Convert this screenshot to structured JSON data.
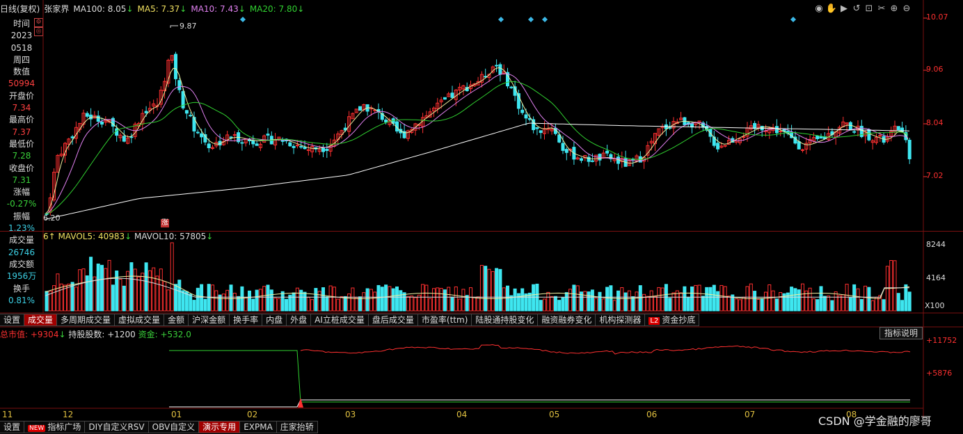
{
  "header": {
    "period": "日线(复权)",
    "stock": "张家界",
    "ma100": "MA100: 8.05",
    "ma5": "MA5: 7.37",
    "ma10": "MA10: 7.43",
    "ma20": "MA20: 7.80",
    "arrow": "↓"
  },
  "info": [
    {
      "label": "时间",
      "value": "2023",
      "cls": "vw"
    },
    {
      "label": "",
      "value": "0518",
      "cls": "vw"
    },
    {
      "label": "",
      "value": "周四",
      "cls": "vw"
    },
    {
      "label": "数值",
      "value": "50994",
      "cls": "vr"
    },
    {
      "label": "开盘价",
      "value": "7.34",
      "cls": "vr"
    },
    {
      "label": "最高价",
      "value": "7.37",
      "cls": "vr"
    },
    {
      "label": "最低价",
      "value": "7.28",
      "cls": "vg"
    },
    {
      "label": "收盘价",
      "value": "7.31",
      "cls": "vg"
    },
    {
      "label": "涨幅",
      "value": "-0.27%",
      "cls": "vg"
    },
    {
      "label": "振幅",
      "value": "1.23%",
      "cls": "vc"
    },
    {
      "label": "成交量",
      "value": "26746",
      "cls": "vc"
    },
    {
      "label": "成交额",
      "value": "1956万",
      "cls": "vc"
    },
    {
      "label": "换手",
      "value": "0.81%",
      "cls": "vc"
    }
  ],
  "price_axis": [
    "10.07",
    "9.06",
    "8.04",
    "7.02"
  ],
  "high_label": "9.87",
  "low_label": "6.20",
  "stop_mark": "涨",
  "volume": {
    "header_prefix": "6↑",
    "mavol5": "MAVOL5: 40983",
    "mavol10": "MAVOL10: 57805",
    "arrow": "↓",
    "axis": [
      "8244",
      "4164"
    ],
    "unit": "X100"
  },
  "tabs1": [
    "设置",
    "成交量",
    "多周期成交量",
    "虚拟成交量",
    "金额",
    "沪深金额",
    "换手率",
    "内盘",
    "外盘",
    "AI立桩成交量",
    "盘后成交量",
    "市盈率(ttm)",
    "陆股通持股变化",
    "融资融券变化",
    "机构探测器",
    "资金抄底"
  ],
  "tabs1_active": 1,
  "tabs1_l2_badge": "L2",
  "lower": {
    "mktval": "总市值: +9304",
    "shares": "持股股数: +1200",
    "fund": "资金: +532.0",
    "arrow": "↓",
    "explain": "指标说明",
    "axis": [
      "+11752",
      "+5876"
    ]
  },
  "months": [
    "11",
    "12",
    "01",
    "02",
    "03",
    "04",
    "05",
    "06",
    "07",
    "08"
  ],
  "tabs2": [
    "设置",
    "指标广场",
    "DIY自定义RSV",
    "OBV自定义",
    "演示专用",
    "EXPMA",
    "庄家抬轿"
  ],
  "tabs2_new_badge": "NEW",
  "tabs2_active": 4,
  "watermark": "CSDN @学金融的廖哥",
  "colors": {
    "up": "#ff3030",
    "down": "#3ee6f0",
    "ma5": "#f0f0a0",
    "ma10": "#e080f0",
    "ma20": "#30d030",
    "ma100": "#ffffff",
    "axis": "#ff3030"
  }
}
